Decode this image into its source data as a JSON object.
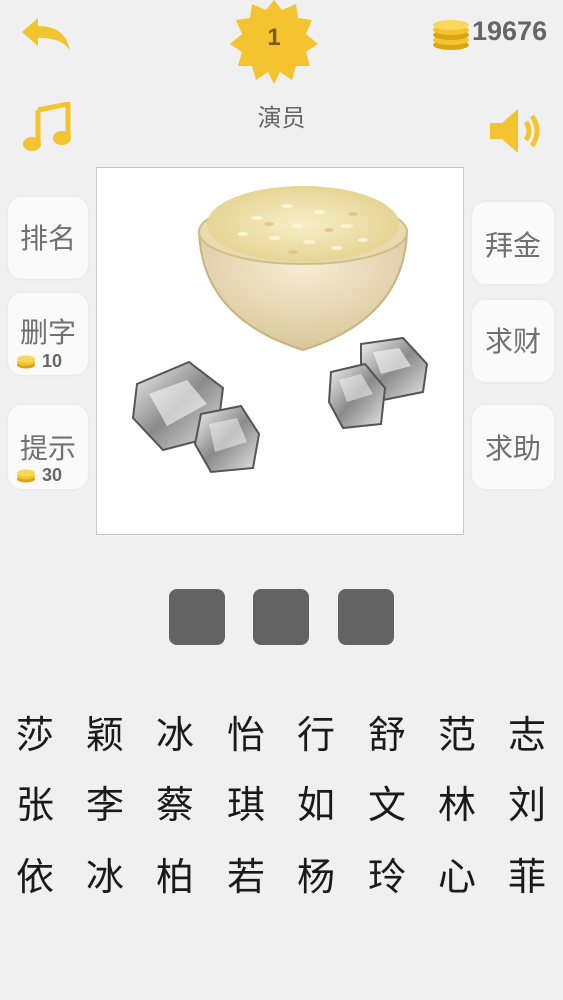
{
  "header": {
    "level": "1",
    "coins": "19676",
    "category": "演员"
  },
  "icons": {
    "back": "back-arrow-icon",
    "music": "music-note-icon",
    "sound": "speaker-icon",
    "coin": "coin-stack-icon",
    "level_badge": "star-badge-icon"
  },
  "left_buttons": [
    {
      "label": "排名"
    },
    {
      "label": "删字",
      "cost": "10"
    },
    {
      "label": "提示",
      "cost": "30"
    }
  ],
  "right_buttons": [
    {
      "label": "拜金"
    },
    {
      "label": "求财"
    },
    {
      "label": "求助"
    }
  ],
  "puzzle": {
    "image": "bowl-of-rice-and-ice-cubes",
    "answer_slots": [
      "",
      "",
      ""
    ]
  },
  "candidates": [
    [
      "莎",
      "颖",
      "冰",
      "怡",
      "行",
      "舒",
      "范",
      "志"
    ],
    [
      "张",
      "李",
      "蔡",
      "琪",
      "如",
      "文",
      "林",
      "刘"
    ],
    [
      "依",
      "冰",
      "柏",
      "若",
      "杨",
      "玲",
      "心",
      "菲"
    ]
  ],
  "colors": {
    "accent_yellow": "#f4c430",
    "background": "#f0f0f0",
    "slot": "#636363"
  }
}
